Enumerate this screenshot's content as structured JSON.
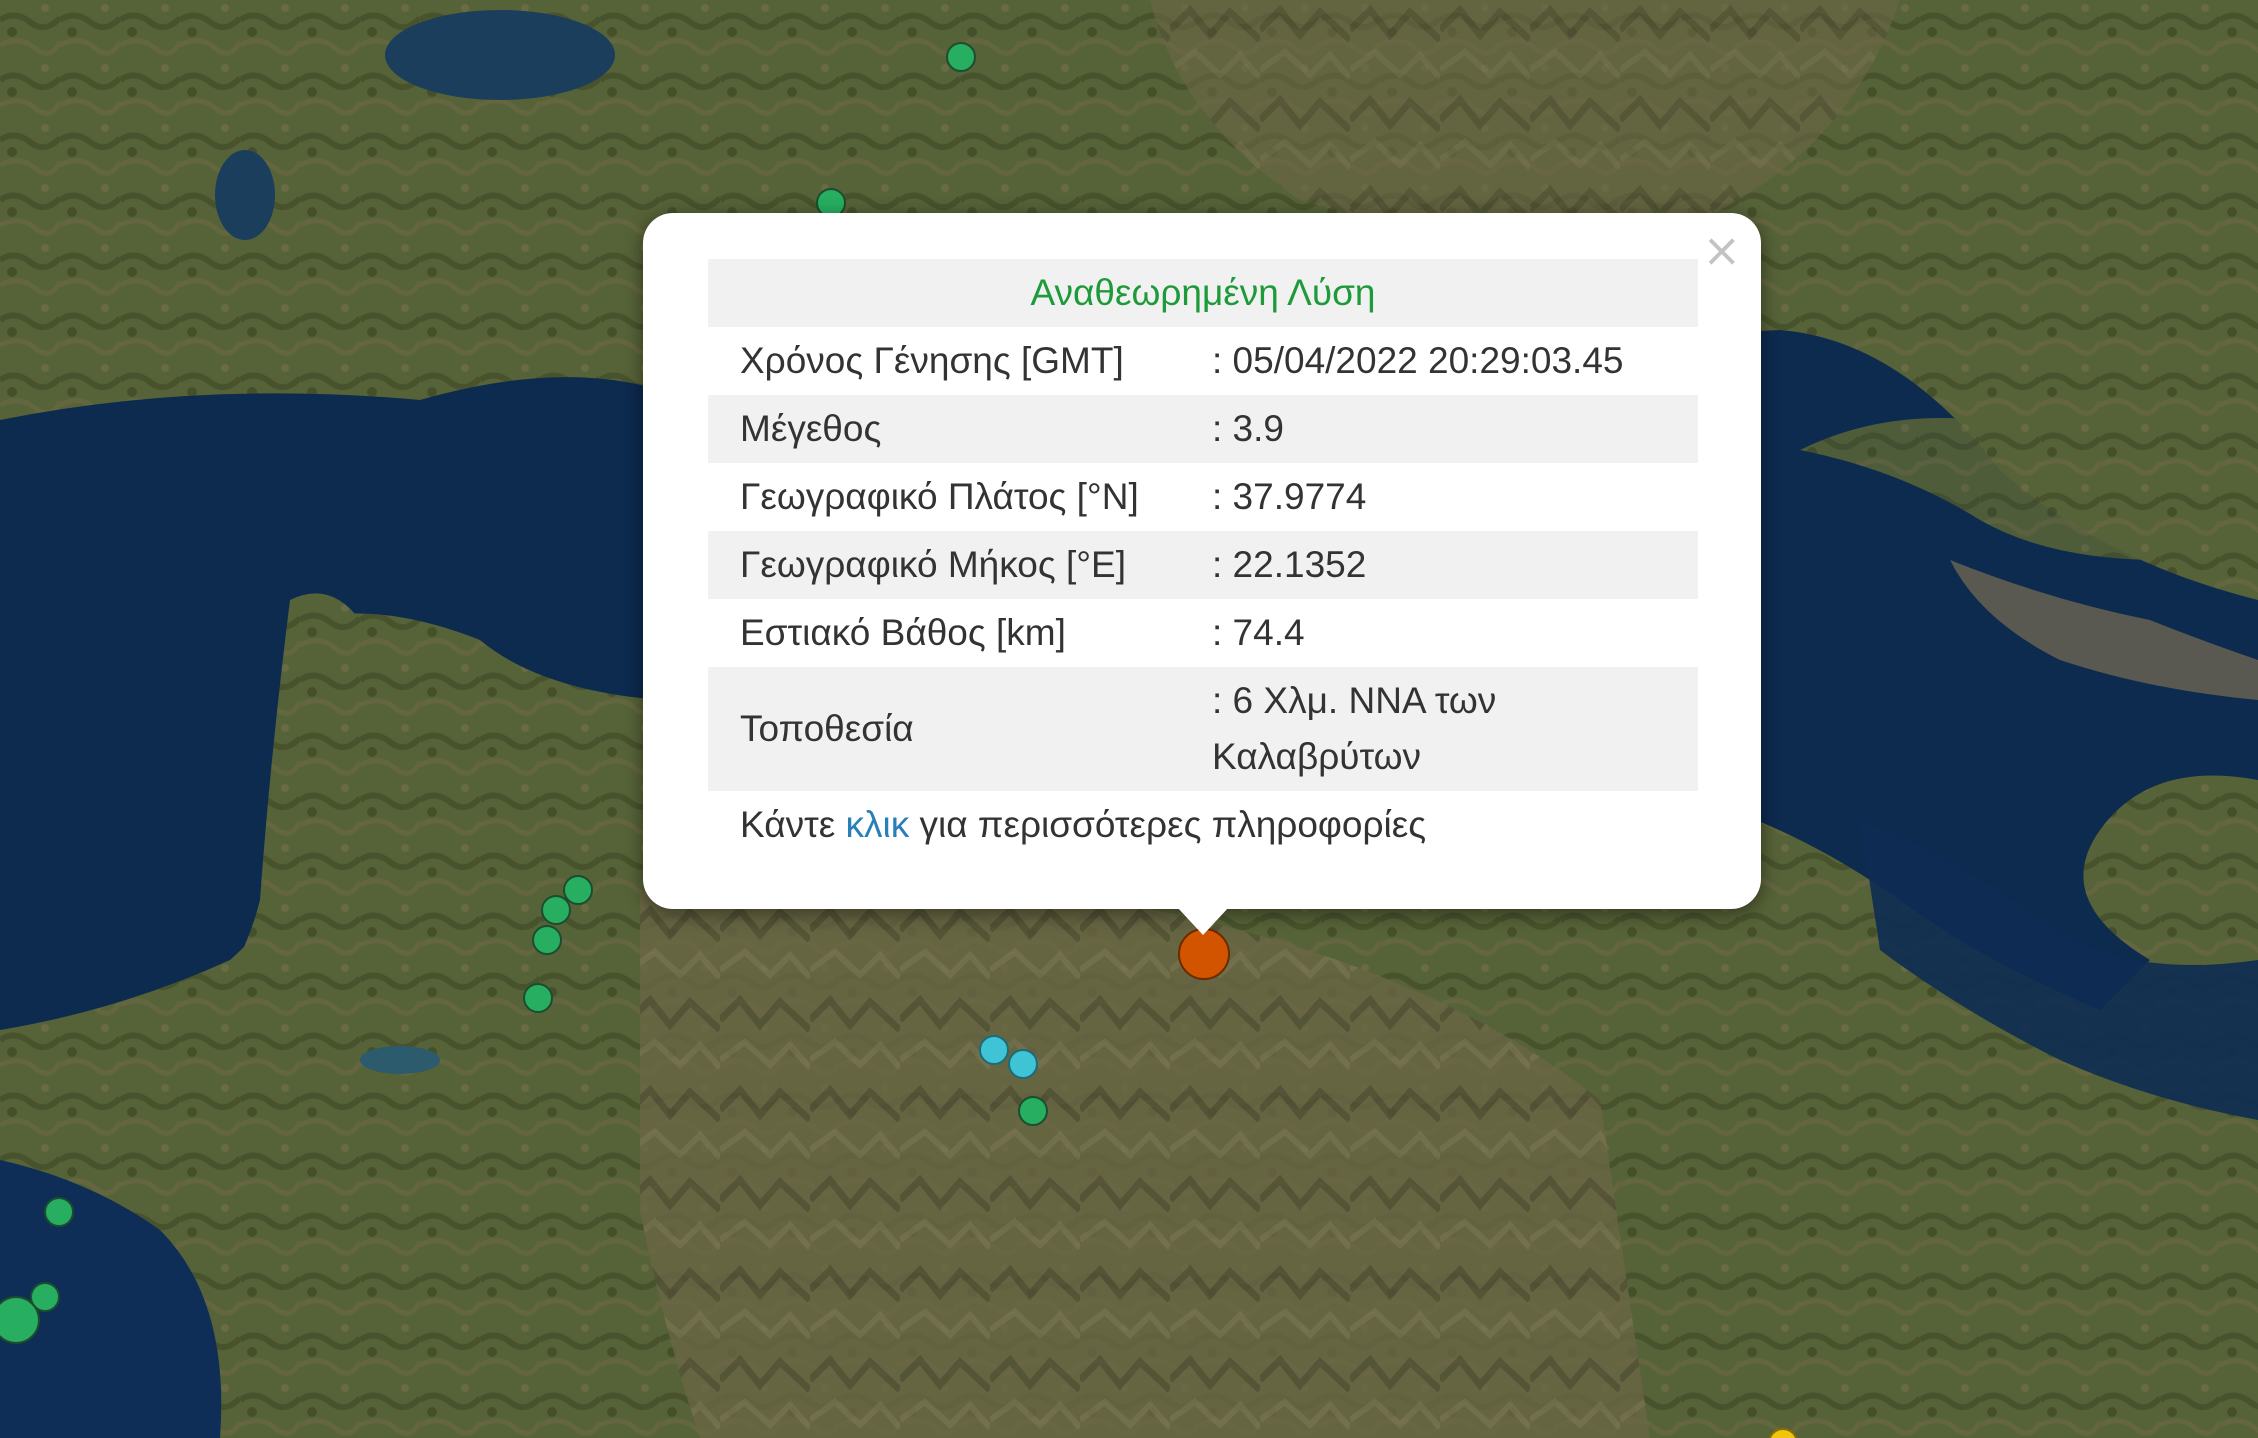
{
  "popup": {
    "close_glyph": "×",
    "header": "Αναθεωρημένη Λύση",
    "rows": [
      {
        "label": "Χρόνος Γένησης [GMT]",
        "value": ": 05/04/2022 20:29:03.45"
      },
      {
        "label": "Μέγεθος",
        "value": ": 3.9"
      },
      {
        "label": "Γεωγραφικό Πλάτος [°N]",
        "value": ": 37.9774"
      },
      {
        "label": "Γεωγραφικό Μήκος [°E]",
        "value": ": 22.1352"
      },
      {
        "label": "Εστιακό Βάθος [km]",
        "value": ": 74.4"
      },
      {
        "label": "Τοποθεσία",
        "value": ": 6 Χλμ. ΝΝΑ των Καλαβρύτων"
      }
    ],
    "more_prefix": "Κάντε ",
    "more_link": "κλικ",
    "more_suffix": " για περισσότερες πληροφορίες"
  },
  "colors": {
    "header_green": "#1e9a3a",
    "link_blue": "#2980b9",
    "marker_green": "#27ae60",
    "marker_cyan": "#3fc4d6",
    "marker_orange": "#d35400",
    "marker_yellow": "#f1c40f",
    "sea": "#0d2a4f",
    "land": "#4f5a32"
  },
  "markers": [
    {
      "color": "green",
      "label": "earthquake-marker"
    },
    {
      "color": "green",
      "label": "earthquake-marker"
    },
    {
      "color": "green",
      "label": "earthquake-marker"
    },
    {
      "color": "green",
      "label": "earthquake-marker"
    },
    {
      "color": "green",
      "label": "earthquake-marker"
    },
    {
      "color": "green",
      "label": "earthquake-marker"
    },
    {
      "color": "cyan",
      "label": "earthquake-marker"
    },
    {
      "color": "cyan",
      "label": "earthquake-marker"
    },
    {
      "color": "green",
      "label": "earthquake-marker"
    },
    {
      "color": "green",
      "label": "earthquake-marker"
    },
    {
      "color": "green",
      "label": "earthquake-marker"
    },
    {
      "color": "green",
      "label": "earthquake-marker"
    },
    {
      "color": "orange",
      "label": "selected-earthquake-marker"
    },
    {
      "color": "yellow",
      "label": "earthquake-marker"
    }
  ]
}
